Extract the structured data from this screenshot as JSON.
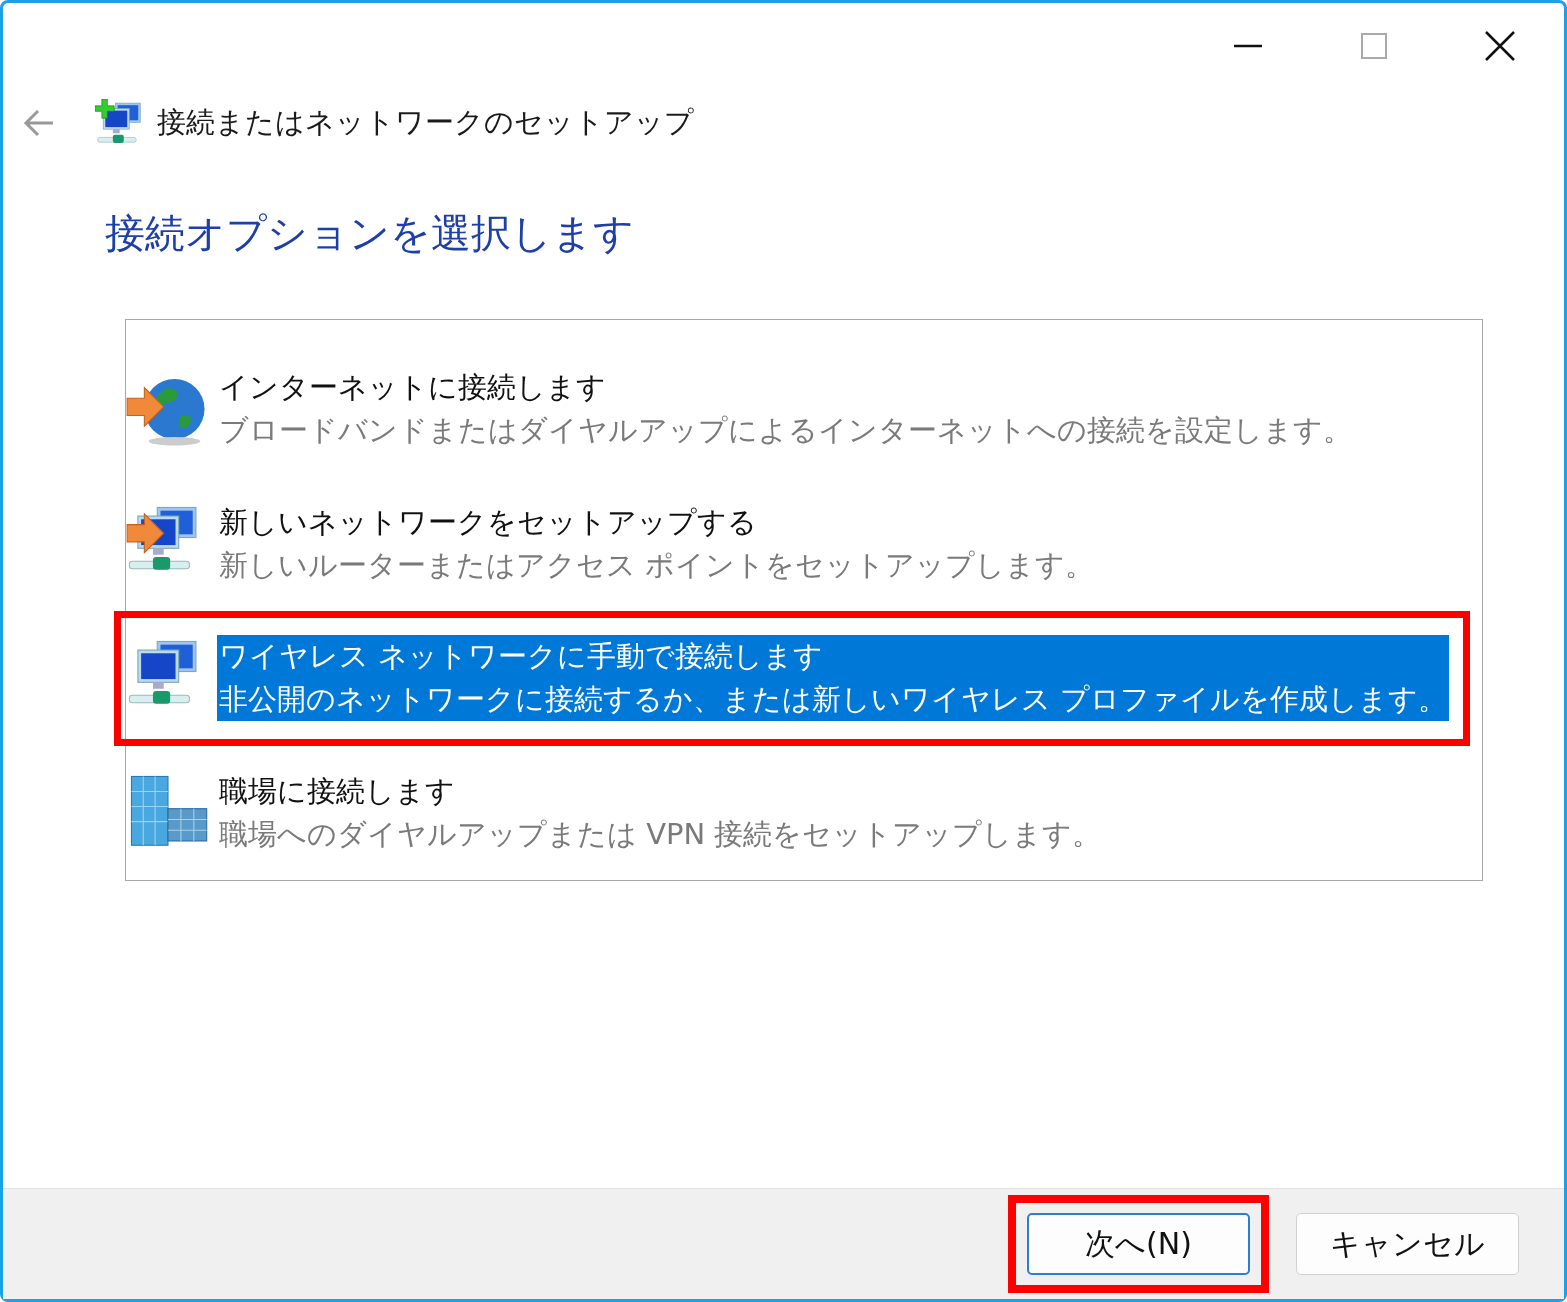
{
  "window": {
    "title": "接続またはネットワークのセットアップ"
  },
  "heading": "接続オプションを選択します",
  "options": [
    {
      "kind": "internet",
      "title": "インターネットに接続します",
      "description": "ブロードバンドまたはダイヤルアップによるインターネットへの接続を設定します。",
      "selected": false,
      "annotated": false
    },
    {
      "kind": "new-network",
      "title": "新しいネットワークをセットアップする",
      "description": "新しいルーターまたはアクセス ポイントをセットアップします。",
      "selected": false,
      "annotated": false
    },
    {
      "kind": "wireless",
      "title": "ワイヤレス ネットワークに手動で接続します",
      "description": "非公開のネットワークに接続するか、または新しいワイヤレス プロファイルを作成します。",
      "selected": true,
      "annotated": true
    },
    {
      "kind": "workplace",
      "title": "職場に接続します",
      "description": "職場へのダイヤルアップまたは VPN 接続をセットアップします。",
      "selected": false,
      "annotated": false
    }
  ],
  "buttons": [
    {
      "label": "次へ(N)",
      "default": true,
      "annotated": true
    },
    {
      "label": "キャンセル",
      "default": false,
      "annotated": false
    }
  ]
}
